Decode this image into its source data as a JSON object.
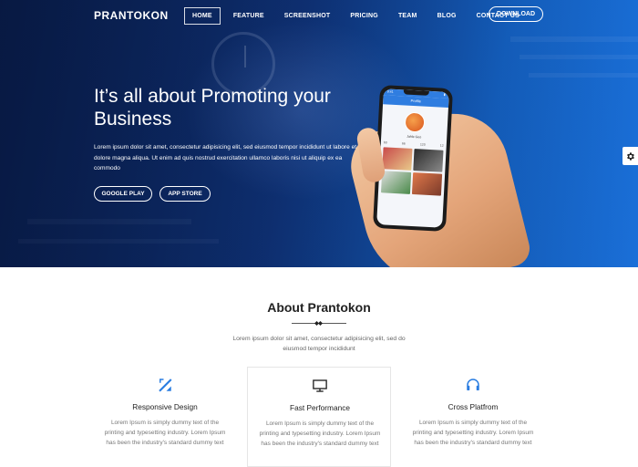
{
  "brand": "PRANTOKON",
  "nav": {
    "items": [
      "HOME",
      "FEATURE",
      "SCREENSHOT",
      "PRICING",
      "TEAM",
      "BLOG",
      "CONTACT US"
    ],
    "active": "HOME",
    "download_label": "DOWNLOAD"
  },
  "hero": {
    "title": "It’s all about Promoting your Business",
    "text": "Lorem ipsum dolor sit amet, consectetur adipisicing elit, sed eiusmod tempor incididunt ut labore et dolore magna aliqua. Ut enim ad quis nostrud exercitation ullamco laboris nisi ut aliquip ex ea commodo",
    "buttons": {
      "google_play": "GOOGLE PLAY",
      "app_store": "APP STORE"
    }
  },
  "phone": {
    "time": "9:41",
    "app_title": "Profile",
    "profile_name": "Jahle Geo",
    "stats": [
      "60",
      "66",
      "120",
      "12"
    ]
  },
  "about": {
    "title": "About Prantokon",
    "subtitle": "Lorem ipsum dolor sit amet, consectetur adipisicing elit, sed do eiusmod tempor incididunt",
    "features": [
      {
        "icon": "design-tools-icon",
        "title": "Responsive Design",
        "text": "Lorem Ipsum is simply dummy text of the printing and typesetting industry. Lorem Ipsum has been the industry's standard dummy text"
      },
      {
        "icon": "monitor-icon",
        "title": "Fast Performance",
        "text": "Lorem Ipsum is simply dummy text of the printing and typesetting industry. Lorem Ipsum has been the industry's standard dummy text"
      },
      {
        "icon": "headset-icon",
        "title": "Cross Platfrom",
        "text": "Lorem Ipsum is simply dummy text of the printing and typesetting industry. Lorem Ipsum has been the industry's standard dummy text"
      }
    ]
  },
  "colors": {
    "accent": "#1565c8",
    "icon_blue": "#2a7de1",
    "hero_dark": "#0a1f4a"
  }
}
